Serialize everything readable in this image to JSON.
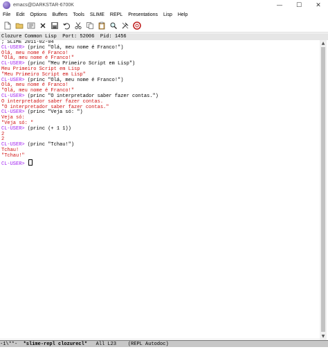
{
  "window": {
    "title": "emacs@DARKSTAR-6700K",
    "minimize": "—",
    "maximize": "☐",
    "close": "✕"
  },
  "menu": [
    "File",
    "Edit",
    "Options",
    "Buffers",
    "Tools",
    "SLIME",
    "REPL",
    "Presentations",
    "Lisp",
    "Help"
  ],
  "toolbar_icons": [
    "new-file-icon",
    "open-folder-icon",
    "dired-icon",
    "close-buffer-icon",
    "save-icon",
    "undo-icon",
    "cut-icon",
    "copy-icon",
    "paste-icon",
    "search-icon",
    "preferences-icon",
    "help-icon"
  ],
  "header_line": "Clozure Common Lisp  Port: 52006  Pid: 1456",
  "repl": [
    {
      "text": "; SLIME 2011-02-04",
      "kind": "blk"
    },
    {
      "prompt": "CL-USER>",
      "text": " (princ \"Olá, meu nome é Franco!\")",
      "kind": "input"
    },
    {
      "text": "Olá, meu nome é Franco!",
      "kind": "red"
    },
    {
      "text": "\"Olá, meu nome é Franco!\"",
      "kind": "red"
    },
    {
      "prompt": "CL-USER>",
      "text": " (princ \"Meu Primeiro Script em Lisp\")",
      "kind": "input"
    },
    {
      "text": "Meu Primeiro Script em Lisp",
      "kind": "red"
    },
    {
      "text": "\"Meu Primeiro Script em Lisp\"",
      "kind": "red"
    },
    {
      "prompt": "CL-USER>",
      "text": " (princ \"Olá, meu nome é Franco!\")",
      "kind": "input"
    },
    {
      "text": "Olá, meu nome é Franco!",
      "kind": "red"
    },
    {
      "text": "\"Olá, meu nome é Franco!\"",
      "kind": "red"
    },
    {
      "prompt": "CL-USER>",
      "text": " (princ \"O interpretador saber fazer contas.\")",
      "kind": "input"
    },
    {
      "text": "O interpretador saber fazer contas.",
      "kind": "red"
    },
    {
      "text": "\"O interpretador saber fazer contas.\"",
      "kind": "red"
    },
    {
      "prompt": "CL-USER>",
      "text": " (princ \"Veja só: \")",
      "kind": "input"
    },
    {
      "text": "Veja só:",
      "kind": "red"
    },
    {
      "text": "\"Veja só: \"",
      "kind": "red"
    },
    {
      "prompt": "CL-USER>",
      "text": " (princ (+ 1 1))",
      "kind": "input"
    },
    {
      "text": "2",
      "kind": "red"
    },
    {
      "text": "2",
      "kind": "red"
    },
    {
      "prompt": "CL-USER>",
      "text": " (princ \"Tchau!\")",
      "kind": "input"
    },
    {
      "text": "Tchau!",
      "kind": "red"
    },
    {
      "text": "\"Tchau!\"",
      "kind": "red"
    },
    {
      "prompt": "CL-USER>",
      "text": " ",
      "kind": "cursor"
    }
  ],
  "modeline": {
    "status": "-1\\**-  ",
    "buffer": "*slime-repl clozurecl*",
    "position": "   All L23    ",
    "modes": "(REPL Autodoc)"
  }
}
